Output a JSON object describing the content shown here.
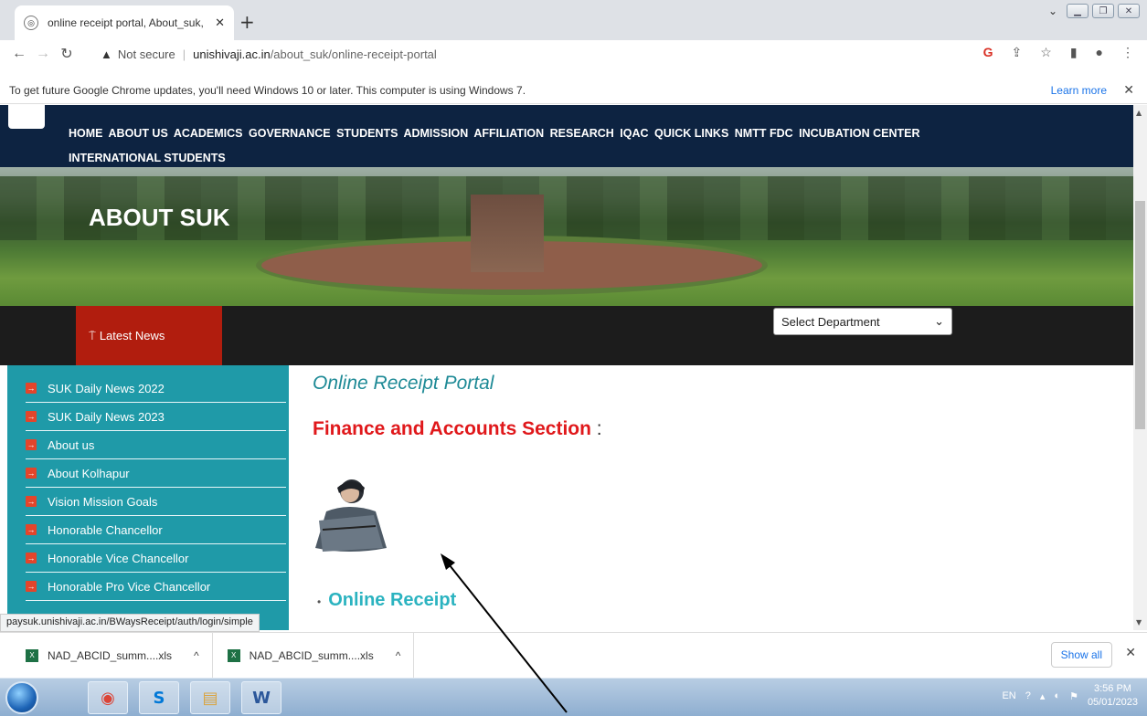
{
  "browser": {
    "tab_title": "online receipt portal, About_suk,",
    "tab_close": "✕",
    "new_tab": "+",
    "omnibox": {
      "security_label": "Not secure",
      "host": "unishivaji.ac.in",
      "path": "/about_suk/online-receipt-portal"
    },
    "infobar": {
      "message": "To get future Google Chrome updates, you'll need Windows 10 or later. This computer is using Windows 7.",
      "learn_more": "Learn more",
      "close": "✕"
    }
  },
  "site": {
    "nav_items": [
      "HOME",
      "ABOUT US",
      "ACADEMICS",
      "GOVERNANCE",
      "STUDENTS",
      "ADMISSION",
      "AFFILIATION",
      "RESEARCH",
      "IQAC",
      "QUICK LINKS",
      "NMTT FDC",
      "INCUBATION CENTER",
      "INTERNATIONAL STUDENTS"
    ],
    "banner_title": "ABOUT SUK",
    "latest_news": "Latest News",
    "department_select": "Select Department",
    "sidebar_items": [
      "SUK Daily News 2022",
      "SUK Daily News 2023",
      "About us",
      "About Kolhapur",
      "Vision Mission Goals",
      "Honorable Chancellor",
      "Honorable Vice Chancellor",
      "Honorable Pro Vice Chancellor"
    ],
    "page_heading": "Online Receipt Portal",
    "section_heading": "Finance and Accounts Section",
    "section_colon": ":",
    "link_bullet": "•",
    "receipt_link": "Online Receipt"
  },
  "status_url": "paysuk.unishivaji.ac.in/BWaysReceipt/auth/login/simple",
  "downloads": {
    "files": [
      "NAD_ABCID_summ....xls",
      "NAD_ABCID_summ....xls"
    ],
    "show_all": "Show all",
    "close": "✕"
  },
  "taskbar": {
    "lang": "EN",
    "time": "3:56 PM",
    "date": "05/01/2023"
  },
  "colors": {
    "navbar": "#0d2341",
    "sidebar": "#1f9aa8",
    "latest_news": "#b11d0e",
    "section_heading": "#e0181b",
    "link": "#2bb3c0"
  }
}
